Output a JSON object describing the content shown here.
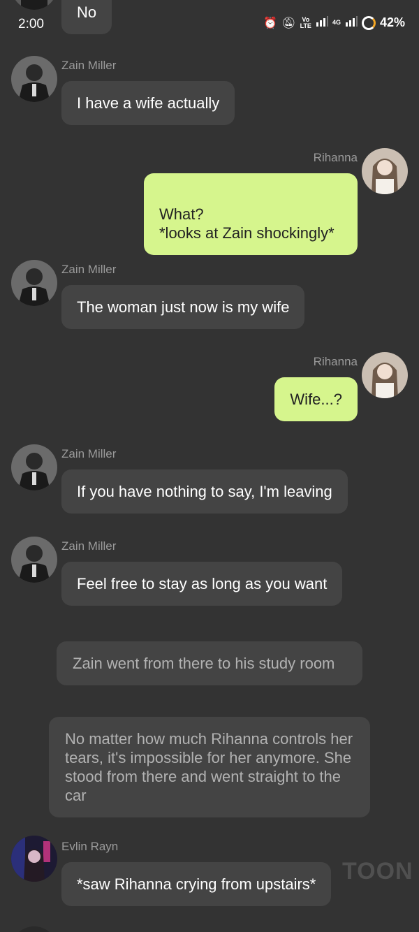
{
  "status_bar": {
    "time": "2:00",
    "volte_label_1": "Vo",
    "volte_label_2": "LTE",
    "net_label": "4G",
    "battery": "42%"
  },
  "messages": [
    {
      "sender": "",
      "text": "No"
    },
    {
      "sender": "Zain Miller",
      "text": "I have a wife actually"
    },
    {
      "sender": "Rihanna",
      "text": "What?\n*looks at Zain shockingly*"
    },
    {
      "sender": "Zain Miller",
      "text": "The woman just now is my wife"
    },
    {
      "sender": "Rihanna",
      "text": "Wife...?"
    },
    {
      "sender": "Zain Miller",
      "text": "If you have nothing to say, I'm leaving"
    },
    {
      "sender": "Zain Miller",
      "text": "Feel free to stay as long as you want"
    },
    {
      "sender": "",
      "text": "Zain went from there to his study room"
    },
    {
      "sender": "",
      "text": "No matter how much Rihanna controls her tears, it's impossible for her anymore. She stood from there and went straight to the car"
    },
    {
      "sender": "Evlin Rayn",
      "text": "*saw Rihanna crying from upstairs*"
    }
  ],
  "watermark": "TOON",
  "colors": {
    "background": "#333333",
    "incoming_bubble": "#444444",
    "outgoing_bubble": "#d6f58d",
    "name_text": "#9a9a9a",
    "narration_text": "#b2b2b2"
  }
}
